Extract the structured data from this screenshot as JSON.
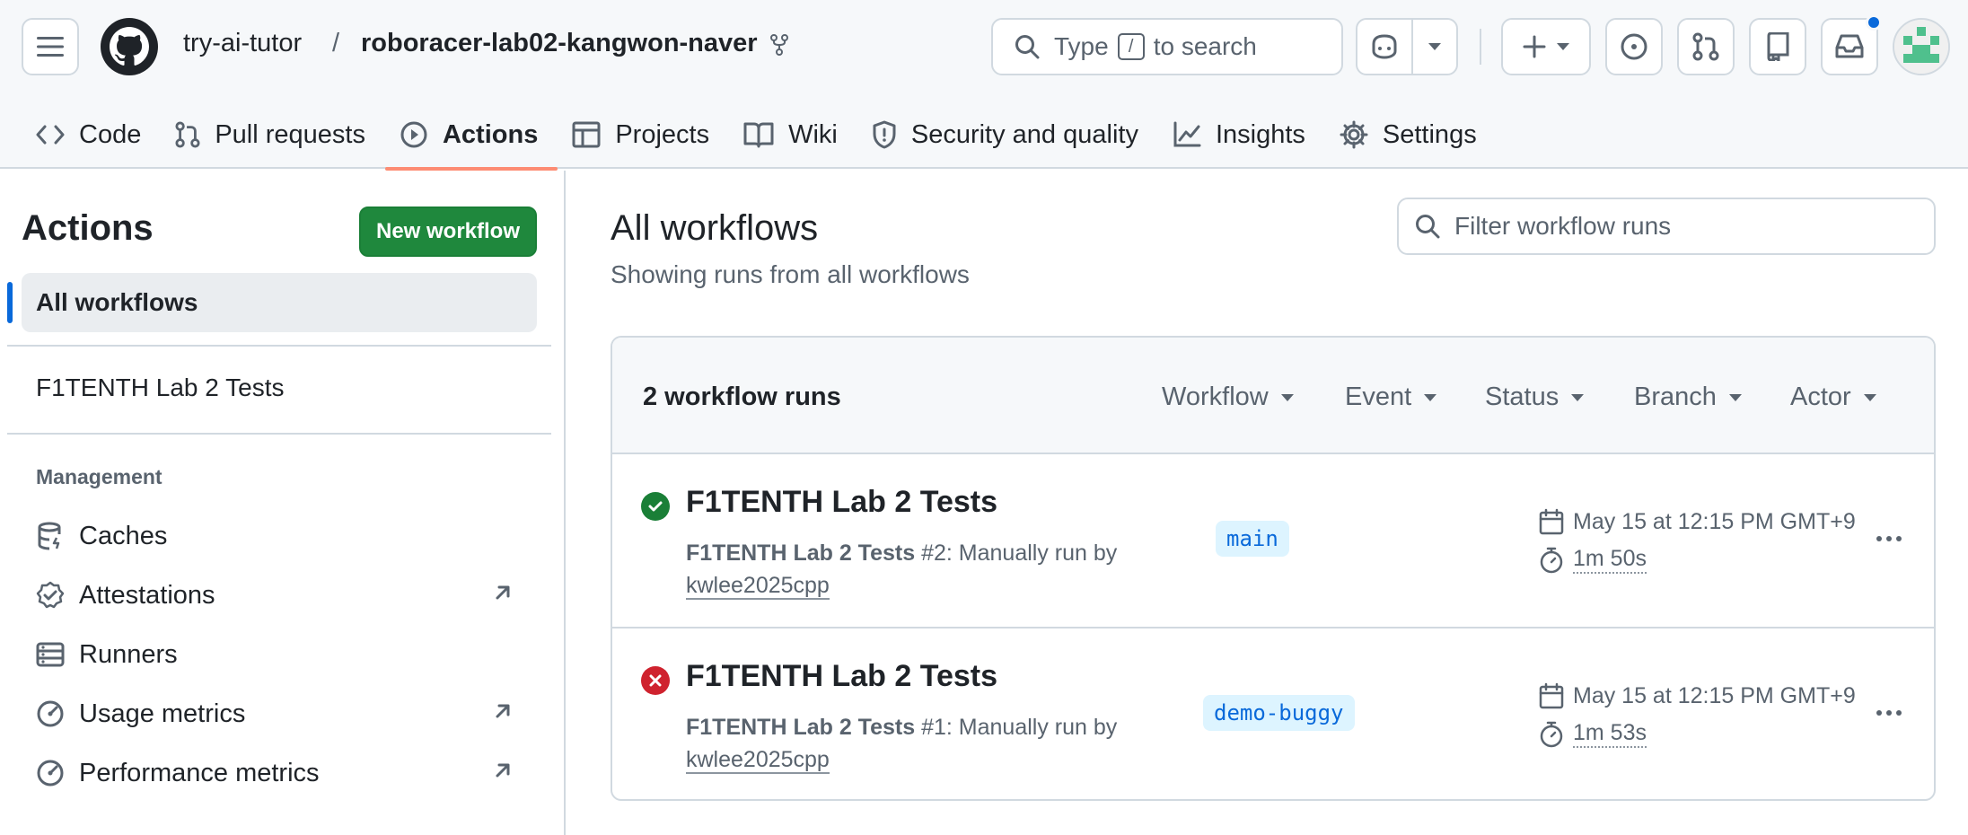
{
  "header": {
    "owner": "try-ai-tutor",
    "separator": "/",
    "repo": "roboracer-lab02-kangwon-naver",
    "search": {
      "prefix": "Type",
      "key": "/",
      "suffix": "to search"
    }
  },
  "repo_nav": [
    {
      "label": "Code",
      "icon": "code-icon"
    },
    {
      "label": "Pull requests",
      "icon": "pull-request-icon"
    },
    {
      "label": "Actions",
      "icon": "play-icon",
      "active": true
    },
    {
      "label": "Projects",
      "icon": "table-icon"
    },
    {
      "label": "Wiki",
      "icon": "book-icon"
    },
    {
      "label": "Security and quality",
      "icon": "shield-icon"
    },
    {
      "label": "Insights",
      "icon": "graph-icon"
    },
    {
      "label": "Settings",
      "icon": "gear-icon"
    }
  ],
  "sidebar": {
    "title": "Actions",
    "new_workflow": "New workflow",
    "all_workflows": "All workflows",
    "workflows": [
      "F1TENTH Lab 2 Tests"
    ],
    "management_heading": "Management",
    "management": [
      {
        "label": "Caches",
        "icon": "database-icon",
        "external": false
      },
      {
        "label": "Attestations",
        "icon": "verified-icon",
        "external": true
      },
      {
        "label": "Runners",
        "icon": "server-icon",
        "external": false
      },
      {
        "label": "Usage metrics",
        "icon": "meter-icon",
        "external": true
      },
      {
        "label": "Performance metrics",
        "icon": "meter-icon",
        "external": true
      }
    ]
  },
  "main": {
    "title": "All workflows",
    "subtitle": "Showing runs from all workflows",
    "filter_placeholder": "Filter workflow runs",
    "runs_count": "2 workflow runs",
    "filters": [
      "Workflow",
      "Event",
      "Status",
      "Branch",
      "Actor"
    ],
    "runs": [
      {
        "title": "F1TENTH Lab 2 Tests",
        "status": "success",
        "workflow": "F1TENTH Lab 2 Tests",
        "number": "#2",
        "trigger": ": Manually run by",
        "actor": "kwlee2025cpp",
        "branch": "main",
        "date": "May 15 at 12:15 PM GMT+9",
        "duration": "1m 50s"
      },
      {
        "title": "F1TENTH Lab 2 Tests",
        "status": "failure",
        "workflow": "F1TENTH Lab 2 Tests",
        "number": "#1",
        "trigger": ": Manually run by",
        "actor": "kwlee2025cpp",
        "branch": "demo-buggy",
        "date": "May 15 at 12:15 PM GMT+9",
        "duration": "1m 53s"
      }
    ]
  },
  "colors": {
    "accent": "#0969da",
    "success": "#1a7f37",
    "danger": "#cf222e",
    "primary_button": "#1f883d",
    "active_tab_underline": "#fd8c73"
  }
}
